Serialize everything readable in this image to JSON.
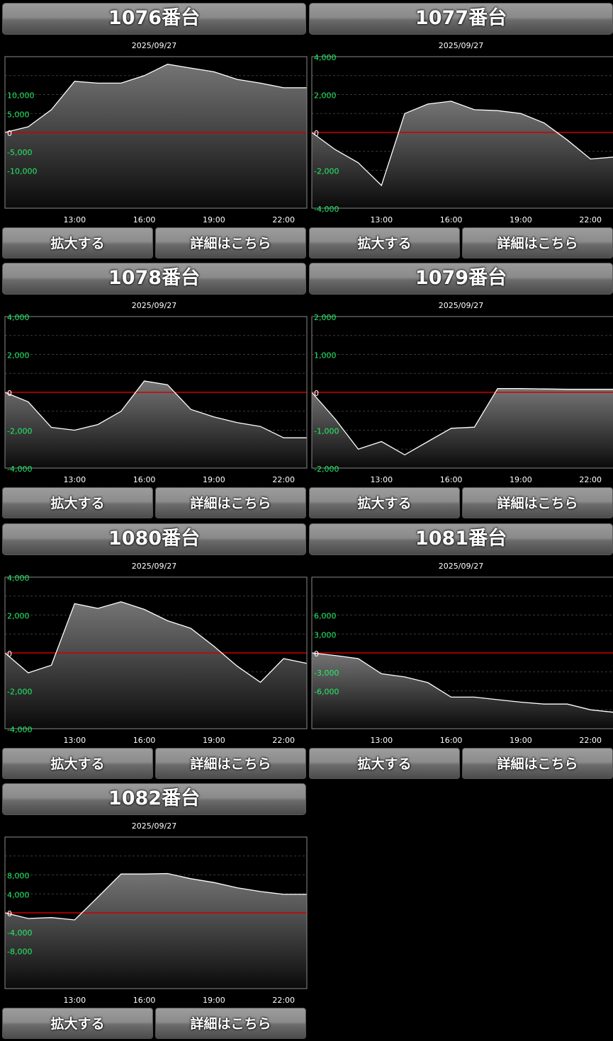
{
  "machines": [
    {
      "title": "1076番台",
      "date": "2025/09/27",
      "zoom_label": "拡大する",
      "detail_label": "詳細はこちら",
      "chart_data": {
        "type": "area",
        "x": [
          "10:00",
          "11:00",
          "12:00",
          "13:00",
          "14:00",
          "15:00",
          "16:00",
          "17:00",
          "18:00",
          "19:00",
          "20:00",
          "21:00",
          "22:00",
          "23:00"
        ],
        "y": [
          0,
          1500,
          6000,
          13500,
          13000,
          13000,
          15000,
          18000,
          17000,
          16000,
          14000,
          13000,
          11800,
          11800
        ],
        "ylim": [
          -20000,
          20000
        ],
        "yticks": [
          -10000,
          -5000,
          0,
          5000,
          10000
        ],
        "ytick_labels": [
          "-10,000",
          "-5,000",
          "0",
          "5,000",
          "10,000"
        ],
        "xtick_labels": [
          "13:00",
          "16:00",
          "19:00",
          "22:00"
        ],
        "grid": true,
        "colors": {
          "line": "#ffffff",
          "zero_line": "#cc0000",
          "tick_label": "#22ee66"
        }
      }
    },
    {
      "title": "1077番台",
      "date": "2025/09/27",
      "zoom_label": "拡大する",
      "detail_label": "詳細はこちら",
      "chart_data": {
        "type": "area",
        "x": [
          "10:00",
          "11:00",
          "12:00",
          "13:00",
          "14:00",
          "15:00",
          "16:00",
          "17:00",
          "18:00",
          "19:00",
          "20:00",
          "21:00",
          "22:00",
          "23:00"
        ],
        "y": [
          0,
          -900,
          -1600,
          -2800,
          1000,
          1500,
          1650,
          1200,
          1150,
          1000,
          500,
          -400,
          -1400,
          -1300
        ],
        "ylim": [
          -4000,
          4000
        ],
        "yticks": [
          -4000,
          -2000,
          0,
          2000,
          4000
        ],
        "ytick_labels": [
          "-4,000",
          "-2,000",
          "0",
          "2,000",
          "4,000"
        ],
        "xtick_labels": [
          "13:00",
          "16:00",
          "19:00",
          "22:00"
        ],
        "grid": true,
        "colors": {
          "line": "#ffffff",
          "zero_line": "#cc0000",
          "tick_label": "#22ee66"
        }
      }
    },
    {
      "title": "1078番台",
      "date": "2025/09/27",
      "zoom_label": "拡大する",
      "detail_label": "詳細はこちら",
      "chart_data": {
        "type": "area",
        "x": [
          "10:00",
          "11:00",
          "12:00",
          "13:00",
          "14:00",
          "15:00",
          "16:00",
          "17:00",
          "18:00",
          "19:00",
          "20:00",
          "21:00",
          "22:00",
          "23:00"
        ],
        "y": [
          0,
          -500,
          -1850,
          -2000,
          -1700,
          -1000,
          600,
          400,
          -900,
          -1300,
          -1600,
          -1800,
          -2400,
          -2400
        ],
        "ylim": [
          -4000,
          4000
        ],
        "yticks": [
          -4000,
          -2000,
          0,
          2000,
          4000
        ],
        "ytick_labels": [
          "-4,000",
          "-2,000",
          "0",
          "2,000",
          "4,000"
        ],
        "xtick_labels": [
          "13:00",
          "16:00",
          "19:00",
          "22:00"
        ],
        "grid": true,
        "colors": {
          "line": "#ffffff",
          "zero_line": "#cc0000",
          "tick_label": "#22ee66"
        }
      }
    },
    {
      "title": "1079番台",
      "date": "2025/09/27",
      "zoom_label": "拡大する",
      "detail_label": "詳細はこちら",
      "chart_data": {
        "type": "area",
        "x": [
          "10:00",
          "11:00",
          "12:00",
          "13:00",
          "14:00",
          "15:00",
          "16:00",
          "17:00",
          "18:00",
          "19:00",
          "20:00",
          "21:00",
          "22:00",
          "23:00"
        ],
        "y": [
          0,
          -700,
          -1500,
          -1300,
          -1650,
          -1300,
          -950,
          -920,
          100,
          100,
          90,
          80,
          80,
          80
        ],
        "ylim": [
          -2000,
          2000
        ],
        "yticks": [
          -2000,
          -1000,
          0,
          1000,
          2000
        ],
        "ytick_labels": [
          "-2,000",
          "-1,000",
          "0",
          "1,000",
          "2,000"
        ],
        "xtick_labels": [
          "13:00",
          "16:00",
          "19:00",
          "22:00"
        ],
        "grid": true,
        "colors": {
          "line": "#ffffff",
          "zero_line": "#cc0000",
          "tick_label": "#22ee66"
        }
      }
    },
    {
      "title": "1080番台",
      "date": "2025/09/27",
      "zoom_label": "拡大する",
      "detail_label": "詳細はこちら",
      "chart_data": {
        "type": "area",
        "x": [
          "10:00",
          "11:00",
          "12:00",
          "13:00",
          "14:00",
          "15:00",
          "16:00",
          "17:00",
          "18:00",
          "19:00",
          "20:00",
          "21:00",
          "22:00",
          "23:00"
        ],
        "y": [
          0,
          -1050,
          -650,
          2600,
          2350,
          2700,
          2300,
          1700,
          1300,
          350,
          -700,
          -1550,
          -300,
          -550
        ],
        "ylim": [
          -4000,
          4000
        ],
        "yticks": [
          -4000,
          -2000,
          0,
          2000,
          4000
        ],
        "ytick_labels": [
          "-4,000",
          "-2,000",
          "0",
          "2,000",
          "4,000"
        ],
        "xtick_labels": [
          "13:00",
          "16:00",
          "19:00",
          "22:00"
        ],
        "grid": true,
        "colors": {
          "line": "#ffffff",
          "zero_line": "#cc0000",
          "tick_label": "#22ee66"
        }
      }
    },
    {
      "title": "1081番台",
      "date": "2025/09/27",
      "zoom_label": "拡大する",
      "detail_label": "詳細はこちら",
      "chart_data": {
        "type": "area",
        "x": [
          "10:00",
          "11:00",
          "12:00",
          "13:00",
          "14:00",
          "15:00",
          "16:00",
          "17:00",
          "18:00",
          "19:00",
          "20:00",
          "21:00",
          "22:00",
          "23:00"
        ],
        "y": [
          0,
          -400,
          -900,
          -3300,
          -3800,
          -4700,
          -7000,
          -7000,
          -7400,
          -7800,
          -8100,
          -8100,
          -9000,
          -9400
        ],
        "ylim": [
          -12000,
          12000
        ],
        "yticks": [
          -6000,
          -3000,
          0,
          3000,
          6000
        ],
        "ytick_labels": [
          "-6,000",
          "-3,000",
          "0",
          "3,000",
          "6,000"
        ],
        "xtick_labels": [
          "13:00",
          "16:00",
          "19:00",
          "22:00"
        ],
        "grid": true,
        "colors": {
          "line": "#ffffff",
          "zero_line": "#cc0000",
          "tick_label": "#22ee66"
        }
      }
    },
    {
      "title": "1082番台",
      "date": "2025/09/27",
      "zoom_label": "拡大する",
      "detail_label": "詳細はこちら",
      "chart_data": {
        "type": "area",
        "x": [
          "10:00",
          "11:00",
          "12:00",
          "13:00",
          "14:00",
          "15:00",
          "16:00",
          "17:00",
          "18:00",
          "19:00",
          "20:00",
          "21:00",
          "22:00",
          "23:00"
        ],
        "y": [
          0,
          -1200,
          -1000,
          -1500,
          3300,
          8200,
          8200,
          8300,
          7200,
          6400,
          5300,
          4500,
          3900,
          3900
        ],
        "ylim": [
          -16000,
          16000
        ],
        "yticks": [
          -8000,
          -4000,
          0,
          4000,
          8000
        ],
        "ytick_labels": [
          "-8,000",
          "-4,000",
          "0",
          "4,000",
          "8,000"
        ],
        "xtick_labels": [
          "13:00",
          "16:00",
          "19:00",
          "22:00"
        ],
        "grid": true,
        "colors": {
          "line": "#ffffff",
          "zero_line": "#cc0000",
          "tick_label": "#22ee66"
        }
      }
    }
  ]
}
